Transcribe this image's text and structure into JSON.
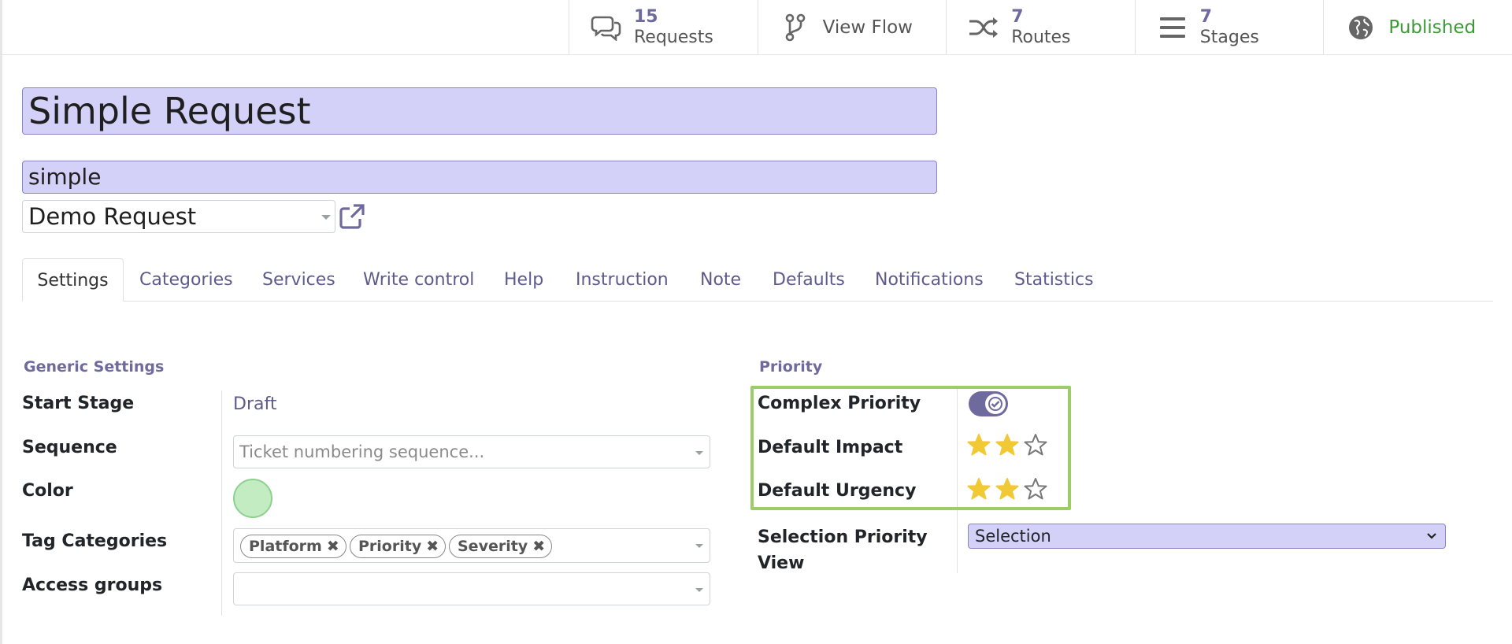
{
  "stats": {
    "requests": {
      "number": "15",
      "label": "Requests"
    },
    "view_flow": {
      "label": "View Flow"
    },
    "routes": {
      "number": "7",
      "label": "Routes"
    },
    "stages": {
      "number": "7",
      "label": "Stages"
    },
    "published": {
      "label": "Published"
    }
  },
  "form": {
    "name": "Simple Request",
    "code": "simple",
    "type": "Demo Request"
  },
  "tabs": [
    "Settings",
    "Categories",
    "Services",
    "Write control",
    "Help",
    "Instruction",
    "Note",
    "Defaults",
    "Notifications",
    "Statistics"
  ],
  "generic": {
    "title": "Generic Settings",
    "start_stage_label": "Start Stage",
    "start_stage_value": "Draft",
    "sequence_label": "Sequence",
    "sequence_placeholder": "Ticket numbering sequence...",
    "color_label": "Color",
    "tag_categories_label": "Tag Categories",
    "tags": [
      "Platform",
      "Priority",
      "Severity"
    ],
    "access_groups_label": "Access groups",
    "color_value": "#c3ecc3"
  },
  "priority": {
    "title": "Priority",
    "complex_label": "Complex Priority",
    "complex_on": true,
    "impact_label": "Default Impact",
    "impact_stars": 2,
    "urgency_label": "Default Urgency",
    "urgency_stars": 2,
    "max_stars": 3,
    "selection_view_label": "Selection Priority View",
    "selection_value": "Selection"
  },
  "colors": {
    "accent": "#6f6a9d",
    "field_bg": "#d3d1f8",
    "published": "#3c9a36",
    "star": "#f0c935",
    "highlight": "#9ccd68"
  }
}
